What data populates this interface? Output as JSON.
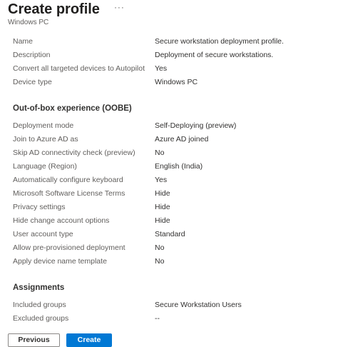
{
  "header": {
    "title": "Create profile",
    "more_icon": "ellipsis-icon",
    "more_glyph": "···",
    "subtitle": "Windows PC"
  },
  "basics": [
    {
      "label": "Name",
      "value": "Secure workstation deployment profile."
    },
    {
      "label": "Description",
      "value": "Deployment of secure workstations."
    },
    {
      "label": "Convert all targeted devices to Autopilot",
      "value": "Yes"
    },
    {
      "label": "Device type",
      "value": "Windows PC"
    }
  ],
  "oobe": {
    "heading": "Out-of-box experience (OOBE)",
    "rows": [
      {
        "label": "Deployment mode",
        "value": "Self-Deploying (preview)"
      },
      {
        "label": "Join to Azure AD as",
        "value": "Azure AD joined"
      },
      {
        "label": "Skip AD connectivity check (preview)",
        "value": "No"
      },
      {
        "label": "Language (Region)",
        "value": "English (India)"
      },
      {
        "label": "Automatically configure keyboard",
        "value": "Yes"
      },
      {
        "label": "Microsoft Software License Terms",
        "value": "Hide"
      },
      {
        "label": "Privacy settings",
        "value": "Hide"
      },
      {
        "label": "Hide change account options",
        "value": "Hide"
      },
      {
        "label": "User account type",
        "value": "Standard"
      },
      {
        "label": "Allow pre-provisioned deployment",
        "value": "No"
      },
      {
        "label": "Apply device name template",
        "value": "No"
      }
    ]
  },
  "assignments": {
    "heading": "Assignments",
    "rows": [
      {
        "label": "Included groups",
        "value": "Secure Workstation Users"
      },
      {
        "label": "Excluded groups",
        "value": "--"
      }
    ]
  },
  "footer": {
    "previous_label": "Previous",
    "create_label": "Create",
    "accent_color": "#0078d4"
  }
}
